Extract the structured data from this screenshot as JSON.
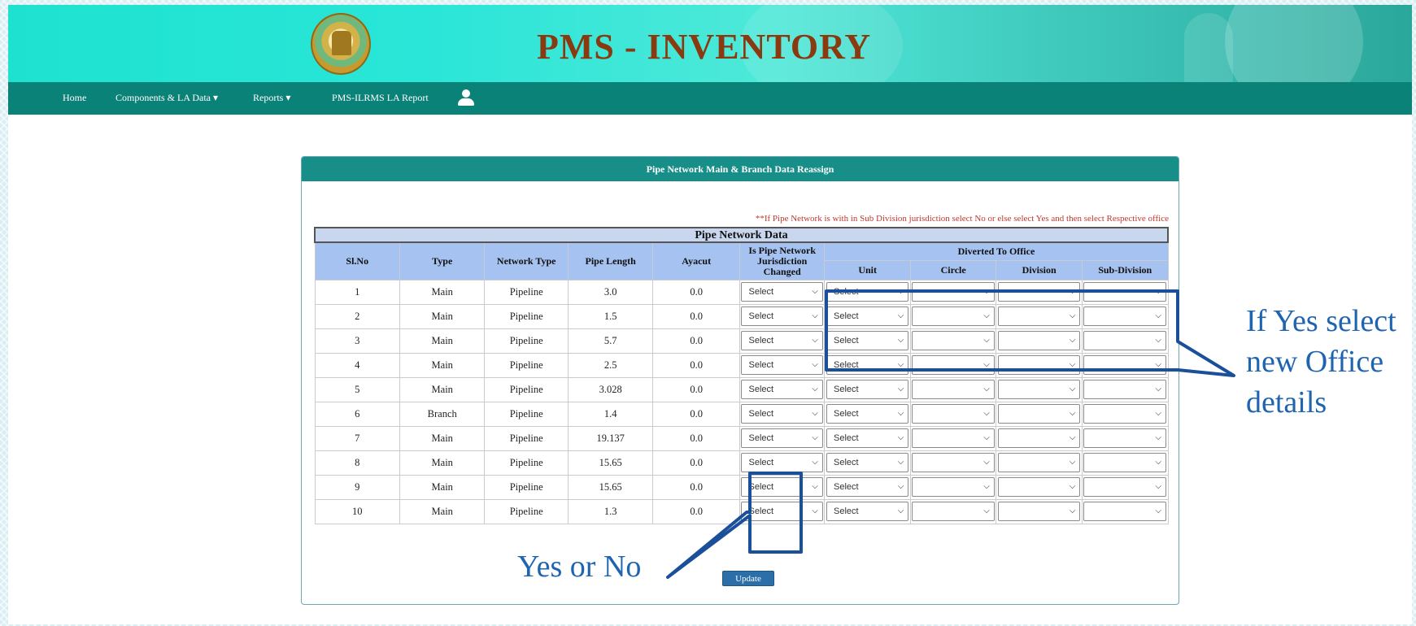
{
  "header": {
    "title": "PMS - INVENTORY"
  },
  "nav": {
    "home": "Home",
    "components": "Components & LA Data ▾",
    "reports": "Reports ▾",
    "la_report": "PMS-ILRMS LA Report"
  },
  "panel": {
    "title": "Pipe Network Main & Branch Data Reassign",
    "note": "**If Pipe Network is with in Sub Division jurisdiction select No or else select Yes and then select Respective office",
    "table_caption": "Pipe Network Data",
    "columns": {
      "slno": "Sl.No",
      "type": "Type",
      "network_type": "Network Type",
      "pipe_length": "Pipe Length",
      "ayacut": "Ayacut",
      "changed": "Is Pipe Network Jurisdiction Changed",
      "diverted": "Diverted To Office",
      "unit": "Unit",
      "circle": "Circle",
      "division": "Division",
      "subdivision": "Sub-Division"
    },
    "select_placeholder": "Select",
    "update_label": "Update",
    "rows": [
      {
        "slno": "1",
        "type": "Main",
        "network_type": "Pipeline",
        "pipe_length": "3.0",
        "ayacut": "0.0"
      },
      {
        "slno": "2",
        "type": "Main",
        "network_type": "Pipeline",
        "pipe_length": "1.5",
        "ayacut": "0.0"
      },
      {
        "slno": "3",
        "type": "Main",
        "network_type": "Pipeline",
        "pipe_length": "5.7",
        "ayacut": "0.0"
      },
      {
        "slno": "4",
        "type": "Main",
        "network_type": "Pipeline",
        "pipe_length": "2.5",
        "ayacut": "0.0"
      },
      {
        "slno": "5",
        "type": "Main",
        "network_type": "Pipeline",
        "pipe_length": "3.028",
        "ayacut": "0.0"
      },
      {
        "slno": "6",
        "type": "Branch",
        "network_type": "Pipeline",
        "pipe_length": "1.4",
        "ayacut": "0.0"
      },
      {
        "slno": "7",
        "type": "Main",
        "network_type": "Pipeline",
        "pipe_length": "19.137",
        "ayacut": "0.0"
      },
      {
        "slno": "8",
        "type": "Main",
        "network_type": "Pipeline",
        "pipe_length": "15.65",
        "ayacut": "0.0"
      },
      {
        "slno": "9",
        "type": "Main",
        "network_type": "Pipeline",
        "pipe_length": "15.65",
        "ayacut": "0.0"
      },
      {
        "slno": "10",
        "type": "Main",
        "network_type": "Pipeline",
        "pipe_length": "1.3",
        "ayacut": "0.0"
      }
    ]
  },
  "annotations": {
    "office_note": [
      "If Yes select",
      "new Office",
      "details"
    ],
    "yes_no": "Yes or No"
  },
  "colors": {
    "accent": "#178e87",
    "annotation": "#1f64b0",
    "title": "#8a3a10"
  }
}
